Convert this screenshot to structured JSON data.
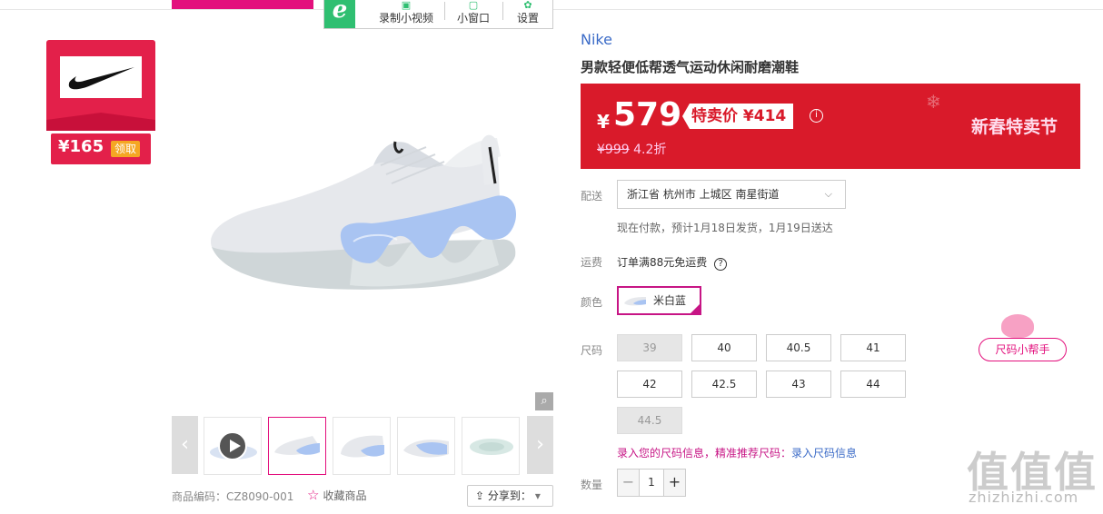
{
  "toolbar": {
    "logo_letter": "e",
    "record_label": "录制小视频",
    "miniwindow_label": "小窗口",
    "settings_label": "设置"
  },
  "brand_badge": {
    "coupon_price": "¥165",
    "coupon_button": "领取"
  },
  "gallery": {
    "thumbnails": [
      "video",
      "image-1",
      "image-2",
      "image-3",
      "image-4"
    ],
    "active_index": 1
  },
  "product": {
    "brand": "Nike",
    "title": "男款轻便低帮透气运动休闲耐磨潮鞋",
    "sku_code": "商品编码：CZ8090-001",
    "favorite_label": "收藏商品",
    "share_label": "分享到："
  },
  "promo": {
    "currency": "¥",
    "price": "579",
    "special_tag": "特卖价 ¥414",
    "original_price": "¥999",
    "discount": "4.2折",
    "festival": "新春特卖节",
    "colors": {
      "background": "#d91a2a"
    }
  },
  "delivery": {
    "label": "配送",
    "address": "浙江省 杭州市 上城区 南星街道",
    "note": "现在付款，预计1月18日发货，1月19日送达"
  },
  "freight": {
    "label": "运费",
    "text": "订单满88元免运费",
    "help": "?"
  },
  "color": {
    "label": "颜色",
    "selected": "米白蓝"
  },
  "size": {
    "label": "尺码",
    "options": [
      "39",
      "40",
      "40.5",
      "41",
      "42",
      "42.5",
      "43",
      "44",
      "44.5"
    ],
    "disabled": [
      "39",
      "44.5"
    ],
    "tip_prefix": "录入您的尺码信息，精准推荐尺码：",
    "tip_link": "录入尺码信息",
    "helper": "尺码小帮手"
  },
  "quantity": {
    "label": "数量",
    "value": "1",
    "minus": "−",
    "plus": "+"
  },
  "watermark": {
    "text": "值值值",
    "url": "zhizhizhi.com"
  }
}
